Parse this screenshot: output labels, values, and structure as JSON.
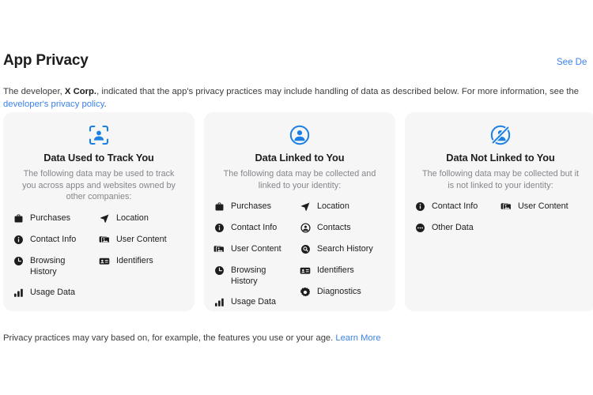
{
  "header": {
    "title": "App Privacy",
    "see_details_label": "See Details"
  },
  "intro": {
    "text_before_developer": "The developer, ",
    "developer_name": "X Corp.",
    "text_after_developer": ", indicated that the app's privacy practices may include handling of data as described below. For more information, see the ",
    "link_label": "developer's privacy policy",
    "text_end": "."
  },
  "cards": [
    {
      "icon": "person-in-viewfinder-icon",
      "title": "Data Used to Track You",
      "subtitle": "The following data may be used to track you across apps and websites owned by other companies:",
      "columns": [
        [
          {
            "icon": "purchases-icon",
            "label": "Purchases"
          },
          {
            "icon": "contact-info-icon",
            "label": "Contact Info"
          },
          {
            "icon": "browsing-history-icon",
            "label": "Browsing\nHistory"
          },
          {
            "icon": "usage-data-icon",
            "label": "Usage Data"
          }
        ],
        [
          {
            "icon": "location-icon",
            "label": "Location"
          },
          {
            "icon": "user-content-icon",
            "label": "User Content"
          },
          {
            "icon": "identifiers-icon",
            "label": "Identifiers"
          }
        ]
      ]
    },
    {
      "icon": "person-in-circle-icon",
      "title": "Data Linked to You",
      "subtitle": "The following data may be collected and linked to your identity:",
      "columns": [
        [
          {
            "icon": "purchases-icon",
            "label": "Purchases"
          },
          {
            "icon": "contact-info-icon",
            "label": "Contact Info"
          },
          {
            "icon": "user-content-icon",
            "label": "User Content"
          },
          {
            "icon": "browsing-history-icon",
            "label": "Browsing\nHistory"
          },
          {
            "icon": "usage-data-icon",
            "label": "Usage Data"
          }
        ],
        [
          {
            "icon": "location-icon",
            "label": "Location"
          },
          {
            "icon": "contacts-icon",
            "label": "Contacts"
          },
          {
            "icon": "search-history-icon",
            "label": "Search History"
          },
          {
            "icon": "identifiers-icon",
            "label": "Identifiers"
          },
          {
            "icon": "diagnostics-icon",
            "label": "Diagnostics"
          }
        ]
      ]
    },
    {
      "icon": "person-in-circle-slashed-icon",
      "title": "Data Not Linked to You",
      "subtitle": "The following data may be collected but it is not linked to your identity:",
      "columns": [
        [
          {
            "icon": "contact-info-icon",
            "label": "Contact Info"
          },
          {
            "icon": "other-data-icon",
            "label": "Other Data"
          }
        ],
        [
          {
            "icon": "user-content-icon",
            "label": "User Content"
          }
        ]
      ]
    }
  ],
  "footer": {
    "text": "Privacy practices may vary based on, for example, the features you use or your age. ",
    "link_label": "Learn More"
  },
  "colors": {
    "link": "#3b82e8",
    "card_background": "#f6f6f7",
    "text_primary": "#1d1d1f",
    "text_secondary": "#86868b",
    "icon_accent": "#1b7fe3"
  }
}
